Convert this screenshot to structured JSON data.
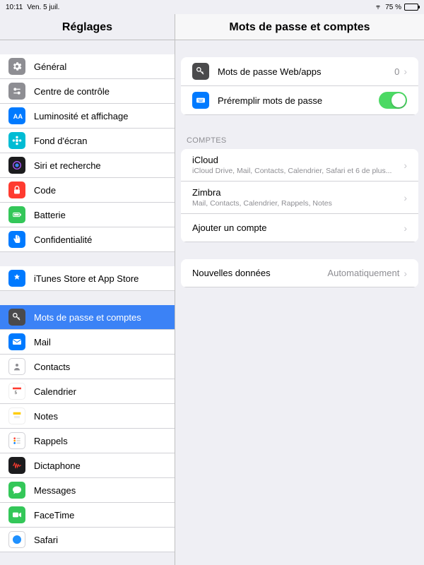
{
  "status": {
    "time": "10:11",
    "date": "Ven. 5 juil.",
    "battery_pct": "75 %"
  },
  "sidebar": {
    "title": "Réglages",
    "groups": [
      [
        {
          "label": "Général",
          "icon": "gear-icon",
          "iconClass": "icon-gray"
        },
        {
          "label": "Centre de contrôle",
          "icon": "switches-icon",
          "iconClass": "icon-gray"
        },
        {
          "label": "Luminosité et affichage",
          "icon": "brightness-icon",
          "iconClass": "icon-blue"
        },
        {
          "label": "Fond d'écran",
          "icon": "flower-icon",
          "iconClass": "icon-teal"
        },
        {
          "label": "Siri et recherche",
          "icon": "siri-icon",
          "iconClass": "icon-black"
        },
        {
          "label": "Code",
          "icon": "lock-icon",
          "iconClass": "icon-red"
        },
        {
          "label": "Batterie",
          "icon": "battery-icon",
          "iconClass": "icon-green"
        },
        {
          "label": "Confidentialité",
          "icon": "hand-icon",
          "iconClass": "icon-bluehand"
        }
      ],
      [
        {
          "label": "iTunes Store et App Store",
          "icon": "appstore-icon",
          "iconClass": "icon-blue"
        }
      ],
      [
        {
          "label": "Mots de passe et comptes",
          "icon": "key-icon",
          "iconClass": "icon-keyicon",
          "selected": true
        },
        {
          "label": "Mail",
          "icon": "mail-icon",
          "iconClass": "icon-blue"
        },
        {
          "label": "Contacts",
          "icon": "contacts-icon",
          "iconClass": "icon-white"
        },
        {
          "label": "Calendrier",
          "icon": "calendar-icon",
          "iconClass": "icon-orangecal"
        },
        {
          "label": "Notes",
          "icon": "notes-icon",
          "iconClass": "icon-yellow"
        },
        {
          "label": "Rappels",
          "icon": "reminders-icon",
          "iconClass": "icon-white"
        },
        {
          "label": "Dictaphone",
          "icon": "voice-icon",
          "iconClass": "icon-black"
        },
        {
          "label": "Messages",
          "icon": "messages-icon",
          "iconClass": "icon-green"
        },
        {
          "label": "FaceTime",
          "icon": "facetime-icon",
          "iconClass": "icon-green"
        },
        {
          "label": "Safari",
          "icon": "safari-icon",
          "iconClass": "icon-white"
        }
      ]
    ]
  },
  "detail": {
    "title": "Mots de passe et comptes",
    "section1": [
      {
        "label": "Mots de passe Web/apps",
        "icon": "key-icon",
        "iconClass": "icon-keyicon",
        "value": "0",
        "type": "link"
      },
      {
        "label": "Préremplir mots de passe",
        "icon": "keyboard-icon",
        "iconClass": "icon-keyboard",
        "type": "toggle",
        "on": true
      }
    ],
    "accounts_header": "Comptes",
    "accounts": [
      {
        "label": "iCloud",
        "sub": "iCloud Drive, Mail, Contacts, Calendrier, Safari et 6 de plus..."
      },
      {
        "label": "Zimbra",
        "sub": "Mail, Contacts, Calendrier, Rappels, Notes"
      },
      {
        "label": "Ajouter un compte"
      }
    ],
    "fetch": {
      "label": "Nouvelles données",
      "value": "Automatiquement"
    }
  }
}
